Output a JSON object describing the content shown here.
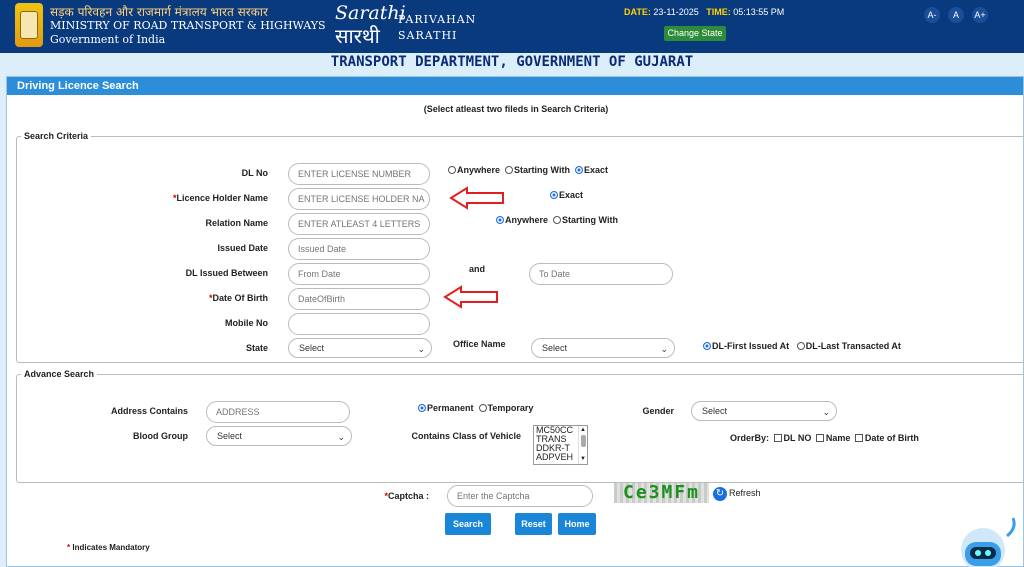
{
  "header": {
    "ministry_hindi": "सड़क परिवहन और राजमार्ग मंत्रालय भारत सरकार",
    "ministry_en": "MINISTRY OF ROAD TRANSPORT & HIGHWAYS",
    "gov": "Government of India",
    "logo_en": "Sarathi",
    "logo_hi": "सारथी",
    "brand1": "PARIVAHAN",
    "brand2": "SARATHI",
    "date_label": "DATE:",
    "date_value": "23-11-2025",
    "time_label": "TIME:",
    "time_value": "05:13:55 PM",
    "change_state": "Change State",
    "font_small": "A-",
    "font_normal": "A",
    "font_large": "A+"
  },
  "department": "TRANSPORT DEPARTMENT, GOVERNMENT OF GUJARAT",
  "panel_title": "Driving Licence Search",
  "note": "(Select atleast two fileds in Search Criteria)",
  "search_criteria": {
    "legend": "Search Criteria",
    "dl_no_label": "DL No",
    "dl_no_placeholder": "ENTER LICENSE NUMBER",
    "holder_name_label": "Licence Holder Name",
    "holder_name_placeholder": "ENTER LICENSE HOLDER NA",
    "relation_name_label": "Relation Name",
    "relation_name_placeholder": "ENTER ATLEAST 4 LETTERS",
    "issued_date_label": "Issued Date",
    "issued_date_placeholder": "Issued Date",
    "issued_between_label": "DL Issued Between",
    "from_date_placeholder": "From Date",
    "and_label": "and",
    "to_date_placeholder": "To Date",
    "dob_label": "Date Of Birth",
    "dob_placeholder": "DateOfBirth",
    "mobile_label": "Mobile No",
    "state_label": "State",
    "state_value": "Select",
    "office_name_label": "Office Name",
    "office_value": "Select",
    "dl_match": {
      "anywhere": "Anywhere",
      "starting": "Starting With",
      "exact": "Exact",
      "selected": "exact"
    },
    "name_match": {
      "exact": "Exact",
      "selected": "exact"
    },
    "relation_match": {
      "anywhere": "Anywhere",
      "starting": "Starting With",
      "selected": "anywhere"
    },
    "office_match": {
      "first": "DL-First Issued At",
      "last": "DL-Last Transacted At",
      "selected": "first"
    }
  },
  "advance_search": {
    "legend": "Advance Search",
    "address_label": "Address Contains",
    "address_placeholder": "ADDRESS",
    "permanent": "Permanent",
    "temporary": "Temporary",
    "address_type_selected": "permanent",
    "gender_label": "Gender",
    "gender_value": "Select",
    "blood_group_label": "Blood Group",
    "blood_group_value": "Select",
    "vehicle_class_label": "Contains Class of Vehicle",
    "vehicle_classes": [
      "MC50CC",
      "TRANS",
      "DDKR-T",
      "ADPVEH"
    ],
    "orderby_label": "OrderBy:",
    "orderby_options": [
      "DL NO",
      "Name",
      "Date of Birth"
    ]
  },
  "captcha": {
    "label": "Captcha :",
    "placeholder": "Enter the Captcha",
    "image_text": "Ce3MFm",
    "refresh": "Refresh"
  },
  "buttons": {
    "search": "Search",
    "reset": "Reset",
    "home": "Home"
  },
  "mandatory_note": "Indicates Mandatory",
  "required_mark": "*",
  "colors": {
    "header": "#0a3a7e",
    "panel_header": "#2c8dd8",
    "button": "#1a86d8",
    "department_text": "#0b2a78",
    "required": "#d00000",
    "arrow": "#e02020"
  }
}
